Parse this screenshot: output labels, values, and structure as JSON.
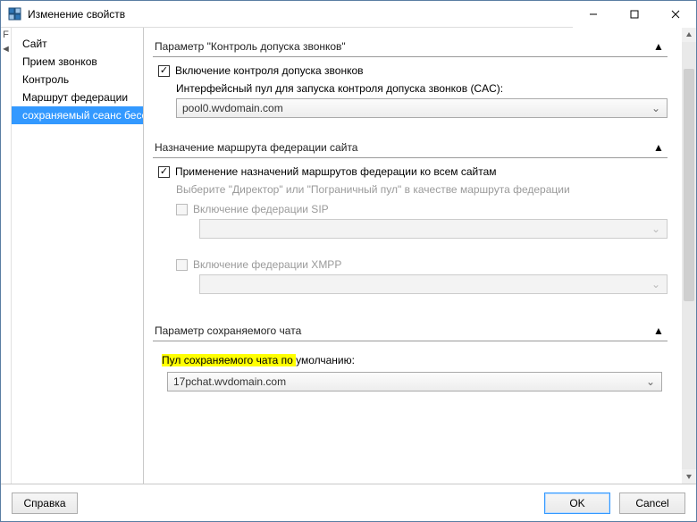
{
  "window": {
    "title": "Изменение свойств"
  },
  "leftStrip": {
    "top": "F",
    "bottom": "◄"
  },
  "sidebar": {
    "items": [
      {
        "label": "Сайт"
      },
      {
        "label": "Прием звонков"
      },
      {
        "label": "Контроль"
      },
      {
        "label": "Маршрут федерации"
      },
      {
        "label": "сохраняемый сеанс беседы"
      }
    ],
    "selectedIndex": 4
  },
  "sections": {
    "cac": {
      "header": "Параметр \"Контроль допуска звонков\"",
      "enable_label": "Включение контроля допуска звонков",
      "enable_checked": true,
      "pool_label": "Интерфейсный пул для запуска контроля допуска звонков (CAC):",
      "pool_value": "pool0.wvdomain.com"
    },
    "fed": {
      "header": "Назначение маршрута федерации сайта",
      "apply_label": "Применение назначений маршрутов федерации ко всем сайтам",
      "apply_checked": true,
      "choose_label": "Выберите \"Директор\" или \"Пограничный пул\" в качестве маршрута федерации",
      "sip_label": "Включение федерации SIP",
      "sip_checked": false,
      "sip_value": "",
      "xmpp_label": "Включение федерации XMPP",
      "xmpp_checked": false,
      "xmpp_value": ""
    },
    "pchat": {
      "header": "Параметр сохраняемого чата",
      "default_label_hl": "Пул сохраняемого чата по ",
      "default_label_rest": "умолчанию:",
      "pool_value": "17pchat.wvdomain.com"
    }
  },
  "footer": {
    "help": "Справка",
    "ok": "OK",
    "cancel": "Cancel"
  }
}
